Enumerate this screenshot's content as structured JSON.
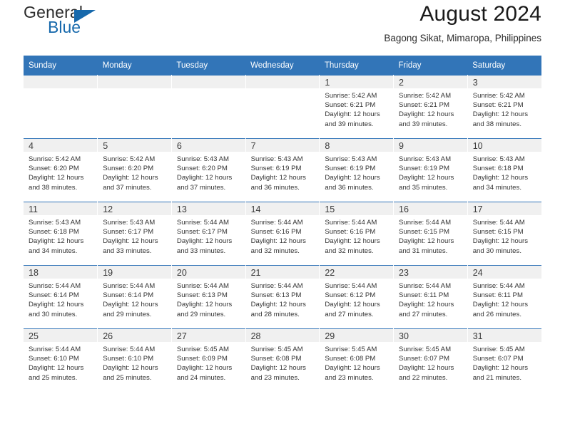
{
  "brand": {
    "name_top": "General",
    "name_bottom": "Blue",
    "accent_color": "#1769ac",
    "triangle_icon": "triangle-icon"
  },
  "header": {
    "title": "August 2024",
    "subtitle": "Bagong Sikat, Mimaropa, Philippines"
  },
  "theme": {
    "header_bar_color": "#3275b8",
    "daynum_band_color": "#f0f0f0",
    "text_color": "#333333"
  },
  "weekdays": [
    "Sunday",
    "Monday",
    "Tuesday",
    "Wednesday",
    "Thursday",
    "Friday",
    "Saturday"
  ],
  "labels": {
    "sunrise_prefix": "Sunrise:",
    "sunset_prefix": "Sunset:",
    "daylight_prefix": "Daylight:"
  },
  "weeks": [
    [
      {
        "day": "",
        "sunrise": "",
        "sunset": "",
        "daylight_line1": "",
        "daylight_line2": ""
      },
      {
        "day": "",
        "sunrise": "",
        "sunset": "",
        "daylight_line1": "",
        "daylight_line2": ""
      },
      {
        "day": "",
        "sunrise": "",
        "sunset": "",
        "daylight_line1": "",
        "daylight_line2": ""
      },
      {
        "day": "",
        "sunrise": "",
        "sunset": "",
        "daylight_line1": "",
        "daylight_line2": ""
      },
      {
        "day": "1",
        "sunrise": "Sunrise: 5:42 AM",
        "sunset": "Sunset: 6:21 PM",
        "daylight_line1": "Daylight: 12 hours",
        "daylight_line2": "and 39 minutes."
      },
      {
        "day": "2",
        "sunrise": "Sunrise: 5:42 AM",
        "sunset": "Sunset: 6:21 PM",
        "daylight_line1": "Daylight: 12 hours",
        "daylight_line2": "and 39 minutes."
      },
      {
        "day": "3",
        "sunrise": "Sunrise: 5:42 AM",
        "sunset": "Sunset: 6:21 PM",
        "daylight_line1": "Daylight: 12 hours",
        "daylight_line2": "and 38 minutes."
      }
    ],
    [
      {
        "day": "4",
        "sunrise": "Sunrise: 5:42 AM",
        "sunset": "Sunset: 6:20 PM",
        "daylight_line1": "Daylight: 12 hours",
        "daylight_line2": "and 38 minutes."
      },
      {
        "day": "5",
        "sunrise": "Sunrise: 5:42 AM",
        "sunset": "Sunset: 6:20 PM",
        "daylight_line1": "Daylight: 12 hours",
        "daylight_line2": "and 37 minutes."
      },
      {
        "day": "6",
        "sunrise": "Sunrise: 5:43 AM",
        "sunset": "Sunset: 6:20 PM",
        "daylight_line1": "Daylight: 12 hours",
        "daylight_line2": "and 37 minutes."
      },
      {
        "day": "7",
        "sunrise": "Sunrise: 5:43 AM",
        "sunset": "Sunset: 6:19 PM",
        "daylight_line1": "Daylight: 12 hours",
        "daylight_line2": "and 36 minutes."
      },
      {
        "day": "8",
        "sunrise": "Sunrise: 5:43 AM",
        "sunset": "Sunset: 6:19 PM",
        "daylight_line1": "Daylight: 12 hours",
        "daylight_line2": "and 36 minutes."
      },
      {
        "day": "9",
        "sunrise": "Sunrise: 5:43 AM",
        "sunset": "Sunset: 6:19 PM",
        "daylight_line1": "Daylight: 12 hours",
        "daylight_line2": "and 35 minutes."
      },
      {
        "day": "10",
        "sunrise": "Sunrise: 5:43 AM",
        "sunset": "Sunset: 6:18 PM",
        "daylight_line1": "Daylight: 12 hours",
        "daylight_line2": "and 34 minutes."
      }
    ],
    [
      {
        "day": "11",
        "sunrise": "Sunrise: 5:43 AM",
        "sunset": "Sunset: 6:18 PM",
        "daylight_line1": "Daylight: 12 hours",
        "daylight_line2": "and 34 minutes."
      },
      {
        "day": "12",
        "sunrise": "Sunrise: 5:43 AM",
        "sunset": "Sunset: 6:17 PM",
        "daylight_line1": "Daylight: 12 hours",
        "daylight_line2": "and 33 minutes."
      },
      {
        "day": "13",
        "sunrise": "Sunrise: 5:44 AM",
        "sunset": "Sunset: 6:17 PM",
        "daylight_line1": "Daylight: 12 hours",
        "daylight_line2": "and 33 minutes."
      },
      {
        "day": "14",
        "sunrise": "Sunrise: 5:44 AM",
        "sunset": "Sunset: 6:16 PM",
        "daylight_line1": "Daylight: 12 hours",
        "daylight_line2": "and 32 minutes."
      },
      {
        "day": "15",
        "sunrise": "Sunrise: 5:44 AM",
        "sunset": "Sunset: 6:16 PM",
        "daylight_line1": "Daylight: 12 hours",
        "daylight_line2": "and 32 minutes."
      },
      {
        "day": "16",
        "sunrise": "Sunrise: 5:44 AM",
        "sunset": "Sunset: 6:15 PM",
        "daylight_line1": "Daylight: 12 hours",
        "daylight_line2": "and 31 minutes."
      },
      {
        "day": "17",
        "sunrise": "Sunrise: 5:44 AM",
        "sunset": "Sunset: 6:15 PM",
        "daylight_line1": "Daylight: 12 hours",
        "daylight_line2": "and 30 minutes."
      }
    ],
    [
      {
        "day": "18",
        "sunrise": "Sunrise: 5:44 AM",
        "sunset": "Sunset: 6:14 PM",
        "daylight_line1": "Daylight: 12 hours",
        "daylight_line2": "and 30 minutes."
      },
      {
        "day": "19",
        "sunrise": "Sunrise: 5:44 AM",
        "sunset": "Sunset: 6:14 PM",
        "daylight_line1": "Daylight: 12 hours",
        "daylight_line2": "and 29 minutes."
      },
      {
        "day": "20",
        "sunrise": "Sunrise: 5:44 AM",
        "sunset": "Sunset: 6:13 PM",
        "daylight_line1": "Daylight: 12 hours",
        "daylight_line2": "and 29 minutes."
      },
      {
        "day": "21",
        "sunrise": "Sunrise: 5:44 AM",
        "sunset": "Sunset: 6:13 PM",
        "daylight_line1": "Daylight: 12 hours",
        "daylight_line2": "and 28 minutes."
      },
      {
        "day": "22",
        "sunrise": "Sunrise: 5:44 AM",
        "sunset": "Sunset: 6:12 PM",
        "daylight_line1": "Daylight: 12 hours",
        "daylight_line2": "and 27 minutes."
      },
      {
        "day": "23",
        "sunrise": "Sunrise: 5:44 AM",
        "sunset": "Sunset: 6:11 PM",
        "daylight_line1": "Daylight: 12 hours",
        "daylight_line2": "and 27 minutes."
      },
      {
        "day": "24",
        "sunrise": "Sunrise: 5:44 AM",
        "sunset": "Sunset: 6:11 PM",
        "daylight_line1": "Daylight: 12 hours",
        "daylight_line2": "and 26 minutes."
      }
    ],
    [
      {
        "day": "25",
        "sunrise": "Sunrise: 5:44 AM",
        "sunset": "Sunset: 6:10 PM",
        "daylight_line1": "Daylight: 12 hours",
        "daylight_line2": "and 25 minutes."
      },
      {
        "day": "26",
        "sunrise": "Sunrise: 5:44 AM",
        "sunset": "Sunset: 6:10 PM",
        "daylight_line1": "Daylight: 12 hours",
        "daylight_line2": "and 25 minutes."
      },
      {
        "day": "27",
        "sunrise": "Sunrise: 5:45 AM",
        "sunset": "Sunset: 6:09 PM",
        "daylight_line1": "Daylight: 12 hours",
        "daylight_line2": "and 24 minutes."
      },
      {
        "day": "28",
        "sunrise": "Sunrise: 5:45 AM",
        "sunset": "Sunset: 6:08 PM",
        "daylight_line1": "Daylight: 12 hours",
        "daylight_line2": "and 23 minutes."
      },
      {
        "day": "29",
        "sunrise": "Sunrise: 5:45 AM",
        "sunset": "Sunset: 6:08 PM",
        "daylight_line1": "Daylight: 12 hours",
        "daylight_line2": "and 23 minutes."
      },
      {
        "day": "30",
        "sunrise": "Sunrise: 5:45 AM",
        "sunset": "Sunset: 6:07 PM",
        "daylight_line1": "Daylight: 12 hours",
        "daylight_line2": "and 22 minutes."
      },
      {
        "day": "31",
        "sunrise": "Sunrise: 5:45 AM",
        "sunset": "Sunset: 6:07 PM",
        "daylight_line1": "Daylight: 12 hours",
        "daylight_line2": "and 21 minutes."
      }
    ]
  ]
}
